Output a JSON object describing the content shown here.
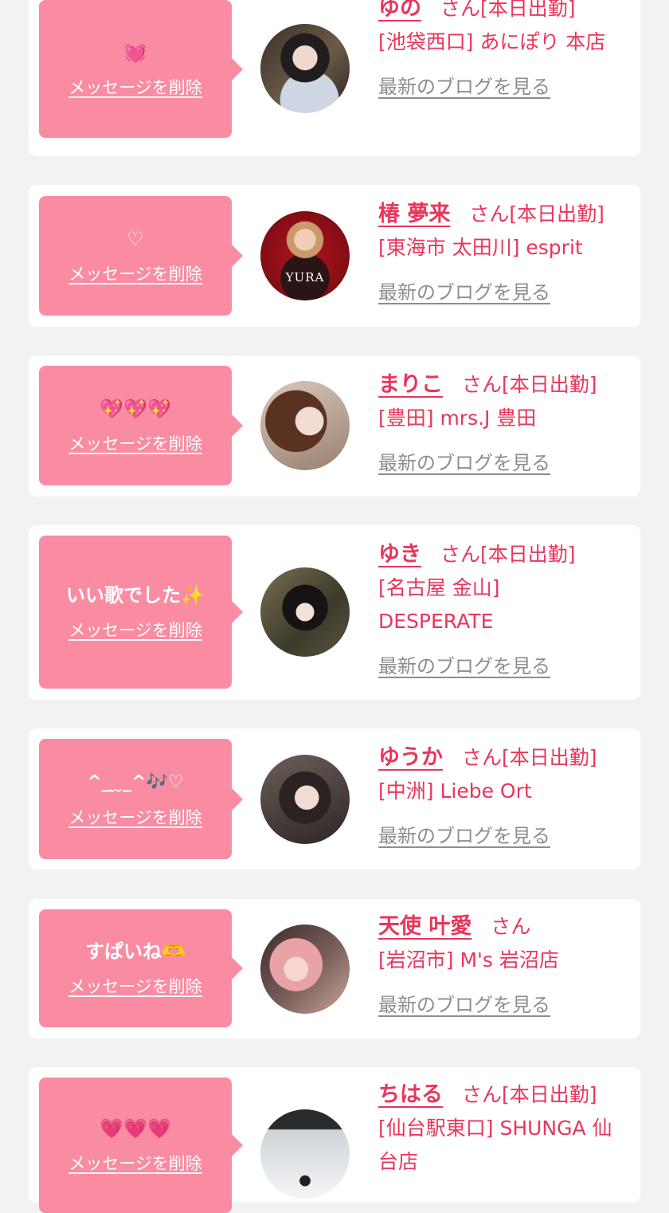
{
  "labels": {
    "delete": "メッセージを削除",
    "blog": "最新のブログを見る",
    "san": "さん"
  },
  "colors": {
    "accent": "#e8365b",
    "bubble": "#f98ca2",
    "background": "#f2f2f2",
    "link_gray": "#8d8d8d"
  },
  "entries": [
    {
      "message": "💓",
      "name": "ゆの",
      "status": "[本日出勤]",
      "shop": "[池袋西口] あにぽり 本店"
    },
    {
      "message": "♡",
      "name": "椿 夢来",
      "status": "[本日出勤]",
      "shop": "[東海市 太田川] esprit",
      "avatar_text": "YURA"
    },
    {
      "message": "💖💖💖",
      "name": "まりこ",
      "status": "[本日出勤]",
      "shop": "[豊田] mrs.J 豊田"
    },
    {
      "message": "いい歌でした✨",
      "name": "ゆき",
      "status": "[本日出勤]",
      "shop": "[名古屋 金山] DESPERATE"
    },
    {
      "message": "^_ ̮  ̮_^🎶♡",
      "name": "ゆうか",
      "status": "[本日出勤]",
      "shop": "[中洲] Liebe Ort"
    },
    {
      "message": "すぱいね🫶",
      "name": "天使 叶愛",
      "status": "",
      "shop": "[岩沼市] M's 岩沼店"
    },
    {
      "message": "💗💗💗",
      "name": "ちはる",
      "status": "[本日出勤]",
      "shop": "[仙台駅東口] SHUNGA 仙台店"
    }
  ]
}
